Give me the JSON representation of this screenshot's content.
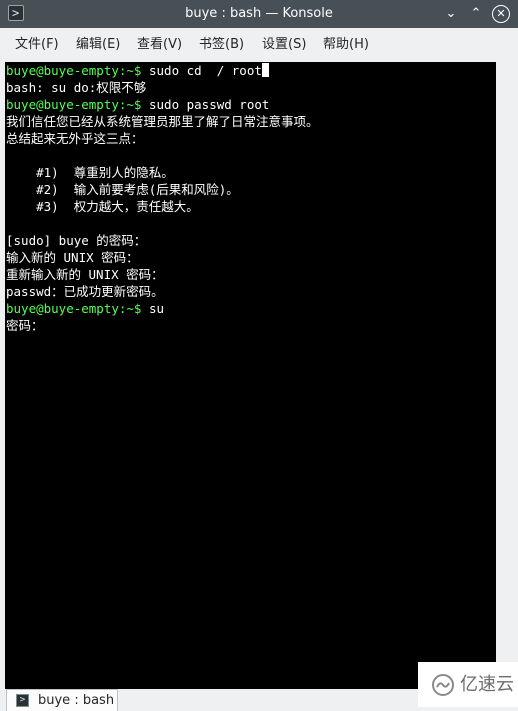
{
  "window": {
    "title": "buye : bash — Konsole",
    "icon": "terminal-icon",
    "minimize_glyph": "⌄",
    "maximize_glyph": "⌃",
    "close_glyph": "✕"
  },
  "menu": {
    "items": [
      "文件(F)",
      "编辑(E)",
      "查看(V)",
      "书签(B)",
      "设置(S)",
      "帮助(H)"
    ]
  },
  "terminal": {
    "background": "#000000",
    "prompt_color": "#54ff54",
    "lines": [
      {
        "prompt": "buye@buye-empty:~$ ",
        "text": "sudo cd  / root"
      },
      {
        "prompt": "",
        "text": "bash: su do:权限不够"
      },
      {
        "prompt": "buye@buye-empty:~$ ",
        "text": "sudo passwd root"
      },
      {
        "prompt": "",
        "text": "我们信任您已经从系统管理员那里了解了日常注意事项。"
      },
      {
        "prompt": "",
        "text": "总结起来无外乎这三点："
      },
      {
        "prompt": "",
        "text": ""
      },
      {
        "prompt": "",
        "text": "    #1)  尊重别人的隐私。"
      },
      {
        "prompt": "",
        "text": "    #2)  输入前要考虑(后果和风险)。"
      },
      {
        "prompt": "",
        "text": "    #3)  权力越大，责任越大。"
      },
      {
        "prompt": "",
        "text": ""
      },
      {
        "prompt": "",
        "text": "[sudo] buye 的密码："
      },
      {
        "prompt": "",
        "text": "输入新的 UNIX 密码："
      },
      {
        "prompt": "",
        "text": "重新输入新的 UNIX 密码："
      },
      {
        "prompt": "",
        "text": "passwd：已成功更新密码。"
      },
      {
        "prompt": "buye@buye-empty:~$ ",
        "text": "su"
      },
      {
        "prompt": "",
        "text": "密码："
      }
    ]
  },
  "tabs": [
    {
      "label": "buye : bash",
      "icon": "terminal-icon"
    }
  ],
  "watermark": {
    "text": "亿速云",
    "logo": "cloud-logo-icon"
  }
}
